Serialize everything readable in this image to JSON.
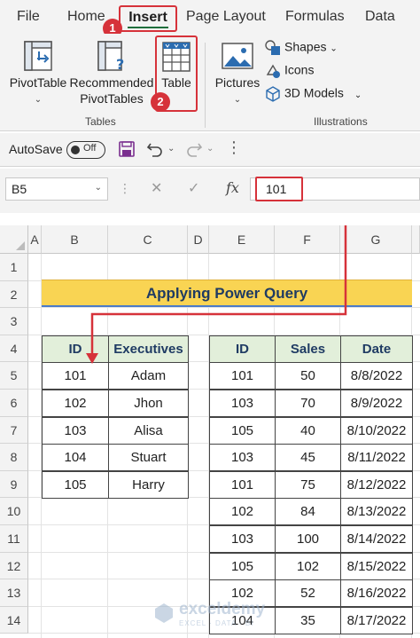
{
  "ribbon_tabs": [
    "File",
    "Home",
    "Insert",
    "Page Layout",
    "Formulas",
    "Data"
  ],
  "callouts": [
    "1",
    "2"
  ],
  "ribbon": {
    "pivottable": "PivotTable",
    "recommended_line1": "Recommended",
    "recommended_line2": "PivotTables",
    "table": "Table",
    "pictures": "Pictures",
    "shapes": "Shapes",
    "icons": "Icons",
    "models_3d": "3D Models",
    "group_tables": "Tables",
    "group_illustrations": "Illustrations"
  },
  "qat": {
    "autosave": "AutoSave",
    "toggle": "Off"
  },
  "formula_bar": {
    "name_box": "B5",
    "fx": "fx",
    "value": "101"
  },
  "columns": [
    "A",
    "B",
    "C",
    "D",
    "E",
    "F",
    "G"
  ],
  "rows": [
    "1",
    "2",
    "3",
    "4",
    "5",
    "6",
    "7",
    "8",
    "9",
    "10",
    "11",
    "12",
    "13",
    "14"
  ],
  "title": "Applying Power Query",
  "table1": {
    "headers": [
      "ID",
      "Executives"
    ],
    "rows": [
      [
        "101",
        "Adam"
      ],
      [
        "102",
        "Jhon"
      ],
      [
        "103",
        "Alisa"
      ],
      [
        "104",
        "Stuart"
      ],
      [
        "105",
        "Harry"
      ]
    ]
  },
  "table2": {
    "headers": [
      "ID",
      "Sales",
      "Date"
    ],
    "rows": [
      [
        "101",
        "50",
        "8/8/2022"
      ],
      [
        "103",
        "70",
        "8/9/2022"
      ],
      [
        "105",
        "40",
        "8/10/2022"
      ],
      [
        "103",
        "45",
        "8/11/2022"
      ],
      [
        "101",
        "75",
        "8/12/2022"
      ],
      [
        "102",
        "84",
        "8/13/2022"
      ],
      [
        "103",
        "100",
        "8/14/2022"
      ],
      [
        "105",
        "102",
        "8/15/2022"
      ],
      [
        "102",
        "52",
        "8/16/2022"
      ],
      [
        "104",
        "35",
        "8/17/2022"
      ]
    ]
  },
  "watermark": {
    "name": "exceldemy",
    "tagline": "EXCEL · DATA · BI"
  },
  "colors": {
    "accent_red": "#d6323a",
    "header_green": "#e2efda",
    "banner_yellow": "#f9d453",
    "banner_text": "#1f3b63"
  }
}
